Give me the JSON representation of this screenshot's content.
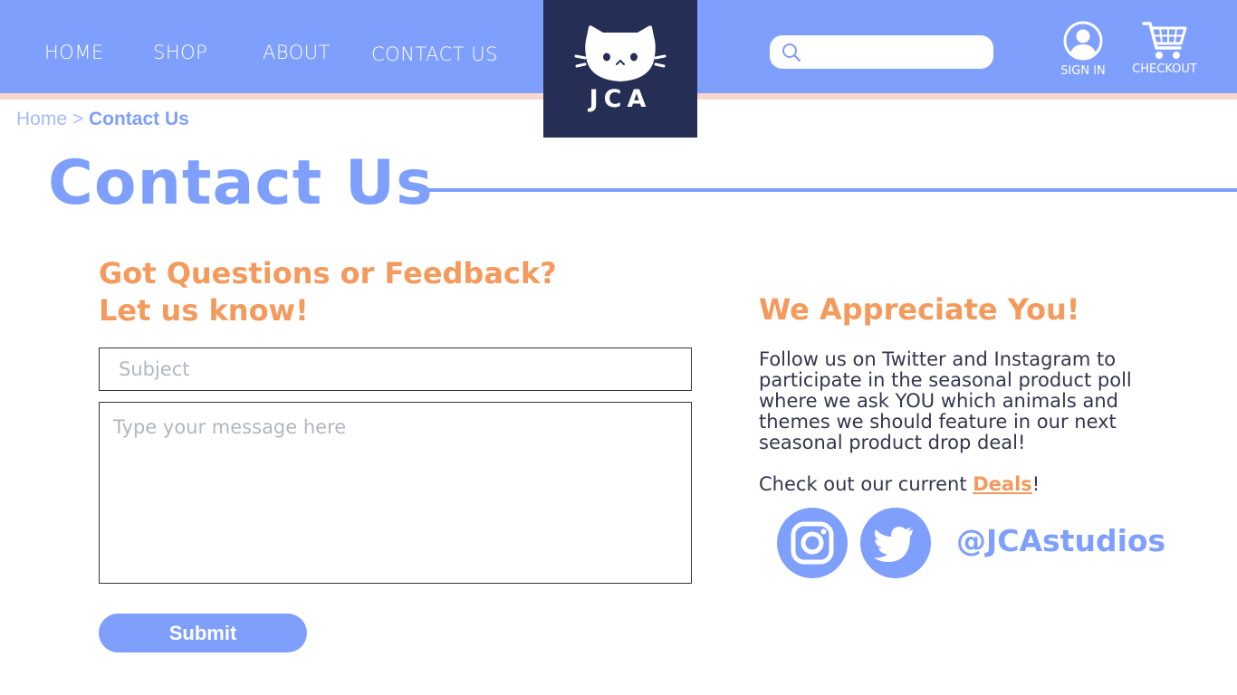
{
  "nav": {
    "home": "HOME",
    "shop": "SHOP",
    "about": "ABOUT",
    "contact": "CONTACT US"
  },
  "logo": {
    "text": "JCA",
    "icon": "cat-face-icon"
  },
  "search": {
    "placeholder": "",
    "icon": "search-icon"
  },
  "actions": {
    "sign_in": "SIGN IN",
    "checkout": "CHECKOUT"
  },
  "breadcrumb": {
    "home": "Home",
    "separator": ">",
    "current": "Contact Us"
  },
  "page": {
    "title": "Contact Us"
  },
  "form": {
    "heading_line1": "Got Questions or Feedback?",
    "heading_line2": "Let us know!",
    "subject_placeholder": "Subject",
    "message_placeholder": "Type your message here",
    "submit_label": "Submit"
  },
  "appreciate": {
    "heading": "We Appreciate You!",
    "paragraph": "Follow us on Twitter and Instagram to participate in the seasonal product poll where we ask YOU which animals and themes we should feature in our next seasonal product drop deal!",
    "deals_prefix": "Check out our current ",
    "deals_link": "Deals",
    "deals_suffix": "!",
    "handle": "@JCAstudios"
  },
  "colors": {
    "primary": "#7f9ffd",
    "navy": "#252f55",
    "accent": "#f39a5c",
    "stripe": "#f8d7cf"
  }
}
